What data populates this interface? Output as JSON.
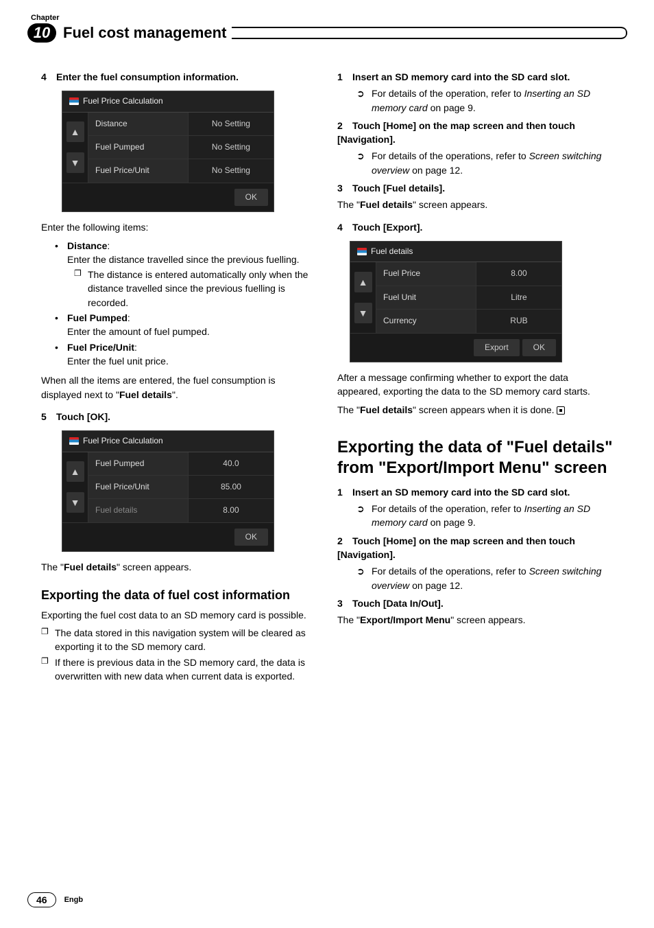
{
  "header": {
    "chapter_label": "Chapter",
    "chapter_number": "10",
    "section_title": "Fuel cost management"
  },
  "left": {
    "step4": {
      "num": "4",
      "text": "Enter the fuel consumption information."
    },
    "ss1": {
      "title": "Fuel Price Calculation",
      "rows": [
        {
          "l": "Distance",
          "r": "No Setting"
        },
        {
          "l": "Fuel Pumped",
          "r": "No Setting"
        },
        {
          "l": "Fuel Price/Unit",
          "r": "No Setting"
        }
      ],
      "ok": "OK"
    },
    "enter_following": "Enter the following items:",
    "bullets": {
      "distance": {
        "head": "Distance",
        "text": "Enter the distance travelled since the previous fuelling.",
        "note": "The distance is entered automatically only when the distance travelled since the previous fuelling is recorded."
      },
      "pumped": {
        "head": "Fuel Pumped",
        "text": "Enter the amount of fuel pumped."
      },
      "unit": {
        "head": "Fuel Price/Unit",
        "text": "Enter the fuel unit price."
      }
    },
    "after_items": {
      "a": "When all the items are entered, the fuel consumption is displayed next to \"",
      "b": "Fuel details",
      "c": "\"."
    },
    "step5": {
      "num": "5",
      "text": "Touch [OK]."
    },
    "ss2": {
      "title": "Fuel Price Calculation",
      "rows": [
        {
          "l": "Fuel Pumped",
          "r": "40.0"
        },
        {
          "l": "Fuel Price/Unit",
          "r": "85.00"
        },
        {
          "l": "Fuel details",
          "r": "8.00",
          "dim": true
        }
      ],
      "ok": "OK"
    },
    "appears": {
      "a": "The \"",
      "b": "Fuel details",
      "c": "\" screen appears."
    },
    "export_heading": "Exporting the data of fuel cost information",
    "export_p": "Exporting the fuel cost data to an SD memory card is possible.",
    "export_note1": "The data stored in this navigation system will be cleared as exporting it to the SD memory card.",
    "export_note2": "If there is previous data in the SD memory card, the data is overwritten with new data when current data is exported."
  },
  "right": {
    "r1": {
      "num": "1",
      "text": "Insert an SD memory card into the SD card slot.",
      "ref_a": "For details of the operation, refer to ",
      "ref_i": "Inserting an SD memory card",
      "ref_b": " on page 9."
    },
    "r2": {
      "num": "2",
      "text": "Touch [Home] on the map screen and then touch [Navigation].",
      "ref_a": "For details of the operations, refer to ",
      "ref_i": "Screen switching overview",
      "ref_b": " on page 12."
    },
    "r3": {
      "num": "3",
      "text": "Touch [Fuel details].",
      "after_a": "The \"",
      "after_b": "Fuel details",
      "after_c": "\" screen appears."
    },
    "r4": {
      "num": "4",
      "text": "Touch [Export]."
    },
    "ss3": {
      "title": "Fuel details",
      "rows": [
        {
          "l": "Fuel Price",
          "r": "8.00"
        },
        {
          "l": "Fuel Unit",
          "r": "Litre"
        },
        {
          "l": "Currency",
          "r": "RUB"
        }
      ],
      "export": "Export",
      "ok": "OK"
    },
    "after_export": "After a message confirming whether to export the data appeared, exporting the data to the SD memory card starts.",
    "done": {
      "a": "The \"",
      "b": "Fuel details",
      "c": "\" screen appears when it is done."
    },
    "big_heading": {
      "a": "Exporting the data of \"",
      "b": "Fuel details",
      "c": "\" from \"",
      "d": "Export/Import Menu",
      "e": "\" screen"
    },
    "b1": {
      "num": "1",
      "text": "Insert an SD memory card into the SD card slot.",
      "ref_a": "For details of the operation, refer to ",
      "ref_i": "Inserting an SD memory card",
      "ref_b": " on page 9."
    },
    "b2": {
      "num": "2",
      "text": "Touch [Home] on the map screen and then touch [Navigation].",
      "ref_a": "For details of the operations, refer to ",
      "ref_i": "Screen switching overview",
      "ref_b": " on page 12."
    },
    "b3": {
      "num": "3",
      "text": "Touch [Data In/Out].",
      "after_a": "The \"",
      "after_b": "Export/Import Menu",
      "after_c": "\" screen appears."
    }
  },
  "footer": {
    "page": "46",
    "lang": "Engb"
  }
}
